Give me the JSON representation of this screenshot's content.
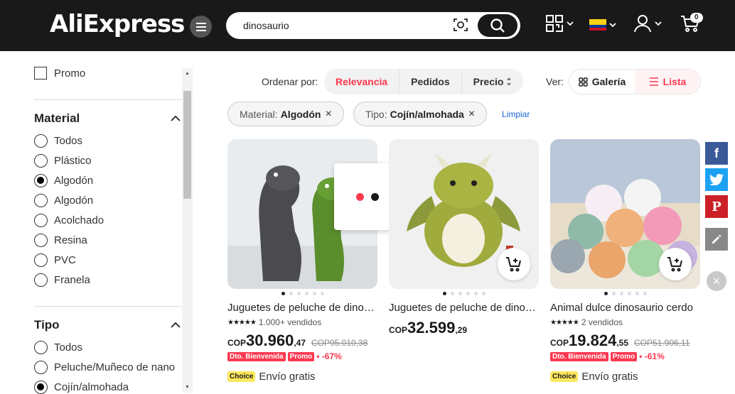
{
  "header": {
    "logo_text": "AliExpress",
    "search_value": "dinosaurio",
    "cart_count": "0"
  },
  "sidebar": {
    "promo_label": "Promo",
    "material": {
      "title": "Material",
      "options": [
        "Todos",
        "Plástico",
        "Algodón",
        "Algodón",
        "Acolchado",
        "Resina",
        "PVC",
        "Franela"
      ],
      "selected_index": 2
    },
    "tipo": {
      "title": "Tipo",
      "options": [
        "Todos",
        "Peluche/Muñeco de nano",
        "Cojín/almohada"
      ],
      "selected_index": 2
    }
  },
  "sort": {
    "label": "Ordenar por:",
    "options": [
      "Relevancia",
      "Pedidos",
      "Precio"
    ],
    "active_index": 0
  },
  "view": {
    "label": "Ver:",
    "gallery": "Galería",
    "list": "Lista",
    "active": "Lista"
  },
  "filters": {
    "chips": [
      {
        "key": "Material:",
        "value": "Algodón"
      },
      {
        "key": "Tipo:",
        "value": "Cojín/almohada"
      }
    ],
    "clear_label": "Limpiar"
  },
  "products": [
    {
      "title": "Juguetes de peluche de dinosaurio",
      "sold": "1.000+ vendidos",
      "currency": "COP",
      "price_main": "30.960",
      "price_dec": ",47",
      "old_price": "COP95.010,38",
      "badge_welcome": "Dto. Bienvenida",
      "badge_promo": "Promo",
      "discount": "• -67%",
      "choice": "Choice",
      "shipping": "Envío gratis"
    },
    {
      "title": "Juguetes de peluche de dinosaurio",
      "currency": "COP",
      "price_main": "32.599",
      "price_dec": ",29"
    },
    {
      "title": "Animal dulce dinosaurio cerdo",
      "sold": "2 vendidos",
      "currency": "COP",
      "price_main": "19.824",
      "price_dec": ",55",
      "old_price": "COP51.906,11",
      "badge_welcome": "Dto. Bienvenida",
      "badge_promo": "Promo",
      "discount": "• -61%",
      "choice": "Choice",
      "shipping": "Envío gratis"
    }
  ],
  "colors": {
    "accent": "#fd384f",
    "header_bg": "#191919",
    "facebook": "#3b5998",
    "twitter": "#1da1f2",
    "pinterest": "#cb2027",
    "edit": "#888888"
  },
  "swatch_colors": [
    "#fd384f",
    "#191919"
  ]
}
